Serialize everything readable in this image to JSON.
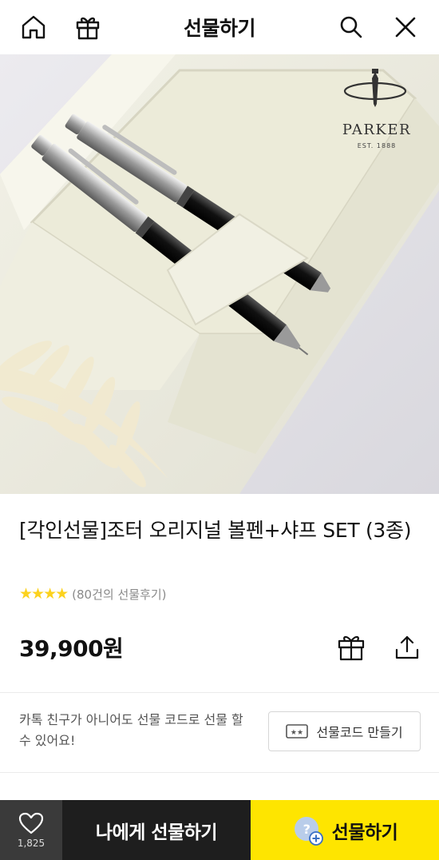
{
  "header": {
    "title": "선물하기",
    "icons": [
      "home-icon",
      "gift-box-icon",
      "search-icon",
      "close-icon"
    ]
  },
  "hero": {
    "brand": "PARKER",
    "brand_est": "EST. 1888"
  },
  "product": {
    "name": "[각인선물]조터 오리지널 볼펜+샤프 SET (3종)",
    "rating_stars": 4,
    "review_text": "(80건의 선물후기)",
    "price": "39,900원"
  },
  "gift_code": {
    "info": "카톡 친구가 아니어도 선물 코드로 선물 할 수 있어요!",
    "button_label": "선물코드 만들기"
  },
  "bottom_bar": {
    "like_count": "1,825",
    "self_gift_label": "나에게 선물하기",
    "gift_label": "선물하기"
  },
  "colors": {
    "accent_yellow": "#FEE500",
    "star_yellow": "#FCD21E",
    "dark_button": "#1E1E1E",
    "like_button": "#3A3A3A"
  }
}
